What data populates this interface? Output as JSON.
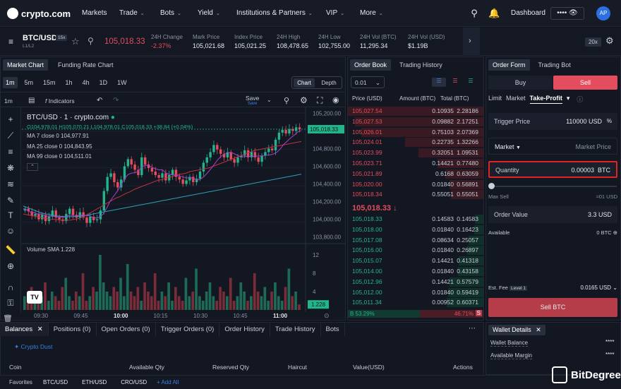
{
  "nav": {
    "logo": "crypto.com",
    "items": [
      {
        "label": "Markets",
        "chev": false
      },
      {
        "label": "Trade",
        "chev": true
      },
      {
        "label": "Bots",
        "chev": true
      },
      {
        "label": "Yield",
        "chev": true
      },
      {
        "label": "Institutions & Partners",
        "chev": true
      },
      {
        "label": "VIP",
        "chev": true
      },
      {
        "label": "More",
        "chev": true
      }
    ],
    "dashboard": "Dashboard",
    "avatar": "AP"
  },
  "ticker": {
    "pair": "BTC/USD",
    "leverage_badge": "15x",
    "sub": "L1/L2",
    "price": "105,018.33",
    "stats": [
      {
        "label": "24H Change",
        "value": "-2.37%"
      },
      {
        "label": "Mark Price",
        "value": "105,021.68"
      },
      {
        "label": "Index Price",
        "value": "105,021.25"
      },
      {
        "label": "24H High",
        "value": "108,478.65"
      },
      {
        "label": "24H Low",
        "value": "102,755.00"
      },
      {
        "label": "24H Vol (BTC)",
        "value": "11,295.34"
      },
      {
        "label": "24H Vol (USD)",
        "value": "$1.19B"
      }
    ],
    "leverage": "20x"
  },
  "chart_panel": {
    "tabs": [
      "Market Chart",
      "Funding Rate Chart"
    ],
    "intervals": [
      "1m",
      "5m",
      "15m",
      "1h",
      "4h",
      "1D",
      "1W"
    ],
    "view_tabs": [
      "Chart",
      "Depth"
    ],
    "toolbar_interval": "1m",
    "indicators": "Indicators",
    "save": "Save",
    "save_sub": "Save",
    "legend": {
      "symbol": "BTC/USD · 1 · crypto.com",
      "ohlc": "O104,978.01  H105,070.21  L104,978.01  C105,018.33  +38.84 (+0.04%)",
      "ma7": "MA 7 close 0  104,977.91",
      "ma25": "MA 25 close 0  104,843.95",
      "ma99": "MA 99 close 0  104,511.01",
      "volume": "Volume SMA  1.228"
    },
    "price_ticks": [
      "105,200.00",
      "104,800.00",
      "104,600.00",
      "104,400.00",
      "104,200.00",
      "104,000.00",
      "103,800.00"
    ],
    "last_price_tag": "105,018.33",
    "volume_ticks": [
      "12",
      "8",
      "4"
    ],
    "volume_tag": "1.228",
    "time_ticks": [
      "09:30",
      "09:45",
      "10:00",
      "10:15",
      "10:30",
      "10:45",
      "11:00"
    ]
  },
  "chart_data": {
    "type": "candlestick",
    "title": "BTC/USD · 1 · crypto.com",
    "ylim": [
      103750,
      105250
    ],
    "last": 105018.33,
    "close_series": [
      104120,
      104090,
      104040,
      104060,
      104000,
      104050,
      103980,
      104030,
      104100,
      104020,
      104000,
      103980,
      104060,
      104120,
      104050,
      104020,
      104080,
      104020,
      103960,
      104030,
      103990,
      104000,
      104100,
      104320,
      104480,
      104520,
      104420,
      104360,
      104450,
      104600,
      104680,
      104620,
      104560,
      104500,
      104700,
      104620,
      104580,
      104540,
      104500,
      104470,
      104520,
      104440,
      104500,
      104560,
      104480,
      104450,
      104400,
      104440,
      104480,
      104420,
      104460,
      104540,
      104640,
      104700,
      104760,
      104840,
      104790,
      104740,
      104700,
      104760,
      104680,
      104640,
      104700,
      104720,
      104780,
      104700,
      104760,
      104700,
      104650,
      104720,
      104760,
      104800,
      104780,
      104900,
      104980,
      105010,
      104970,
      105020,
      105000,
      105040,
      105018
    ],
    "ma25": [
      104060,
      104050,
      104040,
      104030,
      104020,
      104010,
      104000,
      104000,
      103990,
      103990,
      103990,
      104000,
      104010,
      104030,
      104060,
      104090,
      104120,
      104150,
      104180,
      104210,
      104240,
      104260,
      104290,
      104310,
      104340,
      104360,
      104380,
      104400,
      104420,
      104440,
      104450,
      104470,
      104480,
      104500,
      104510,
      104520,
      104540,
      104550,
      104560,
      104570,
      104580,
      104600,
      104620,
      104640,
      104660,
      104680,
      104700,
      104720,
      104740,
      104760,
      104780,
      104790,
      104800,
      104810,
      104820,
      104830,
      104840,
      104850,
      104860,
      104870,
      104880
    ],
    "ma99": [
      104150,
      104130,
      104110,
      104090,
      104070,
      104060,
      104050,
      104040,
      104035,
      104030,
      104030,
      104030,
      104035,
      104040,
      104050,
      104060,
      104070,
      104080,
      104090,
      104100,
      104110,
      104120,
      104130,
      104140,
      104150,
      104160,
      104170,
      104180,
      104190,
      104200,
      104210,
      104220,
      104230,
      104240,
      104250,
      104260,
      104270,
      104280,
      104290,
      104300,
      104310,
      104320,
      104330,
      104340,
      104350,
      104360,
      104370,
      104380,
      104390,
      104400,
      104410,
      104420,
      104430,
      104440,
      104450,
      104460,
      104470,
      104480,
      104490,
      104500,
      104511
    ],
    "volume": [
      3,
      2,
      5,
      4,
      2,
      3,
      6,
      2,
      4,
      3,
      2,
      5,
      7,
      3,
      2,
      4,
      3,
      8,
      2,
      3,
      5,
      4,
      12,
      6,
      4,
      3,
      5,
      4,
      7,
      3,
      10,
      4,
      3,
      5,
      2,
      6,
      4,
      3,
      8,
      2,
      4,
      3,
      6,
      2,
      5,
      3,
      2,
      7,
      3,
      4,
      9,
      3,
      2,
      4,
      6,
      3,
      2,
      5,
      4,
      3,
      7,
      2,
      3,
      6,
      4,
      2,
      3,
      8,
      4,
      3,
      5,
      2,
      4,
      6,
      3,
      2,
      5,
      9,
      3,
      4,
      1.2
    ],
    "volume_ylim": [
      0,
      14
    ]
  },
  "orderbook": {
    "tabs": [
      "Order Book",
      "Trading History"
    ],
    "precision": "0.01",
    "headers": [
      "Price (USD)",
      "Amount (BTC)",
      "Total (BTC)"
    ],
    "asks": [
      {
        "price": "105,027.54",
        "amount": "0.10935",
        "total": "2.28186",
        "depth": 1.0
      },
      {
        "price": "105,027.53",
        "amount": "0.09882",
        "total": "2.17251",
        "depth": 0.95
      },
      {
        "price": "105,026.01",
        "amount": "0.75103",
        "total": "2.07369",
        "depth": 0.9
      },
      {
        "price": "105,024.01",
        "amount": "0.22735",
        "total": "1.32266",
        "depth": 0.58
      },
      {
        "price": "105,023.99",
        "amount": "0.32051",
        "total": "1.09531",
        "depth": 0.48
      },
      {
        "price": "105,023.71",
        "amount": "0.14421",
        "total": "0.77480",
        "depth": 0.34
      },
      {
        "price": "105,021.89",
        "amount": "0.6168",
        "total": "0.63059",
        "depth": 0.28
      },
      {
        "price": "105,020.00",
        "amount": "0.01840",
        "total": "0.56891",
        "depth": 0.25
      },
      {
        "price": "105,018.34",
        "amount": "0.55051",
        "total": "0.55051",
        "depth": 0.24
      }
    ],
    "mid_price": "105,018.33",
    "bids": [
      {
        "price": "105,018.33",
        "amount": "0.14583",
        "total": "0.14583",
        "depth": 0.06
      },
      {
        "price": "105,018.00",
        "amount": "0.01840",
        "total": "0.16423",
        "depth": 0.07
      },
      {
        "price": "105,017.08",
        "amount": "0.08634",
        "total": "0.25057",
        "depth": 0.11
      },
      {
        "price": "105,016.00",
        "amount": "0.01840",
        "total": "0.26897",
        "depth": 0.12
      },
      {
        "price": "105,015.07",
        "amount": "0.14421",
        "total": "0.41318",
        "depth": 0.18
      },
      {
        "price": "105,014.00",
        "amount": "0.01840",
        "total": "0.43158",
        "depth": 0.19
      },
      {
        "price": "105,012.96",
        "amount": "0.14421",
        "total": "0.57579",
        "depth": 0.25
      },
      {
        "price": "105,012.00",
        "amount": "0.01840",
        "total": "0.59419",
        "depth": 0.26
      },
      {
        "price": "105,011.34",
        "amount": "0.00952",
        "total": "0.60371",
        "depth": 0.27
      }
    ],
    "buy_ratio": "B 53.29%",
    "sell_ratio": "46.71%",
    "sell_badge": "S",
    "buy_fraction": 0.5329
  },
  "order_form": {
    "tabs": [
      "Order Form",
      "Trading Bot"
    ],
    "buy": "Buy",
    "sell": "Sell",
    "types": [
      "Limit",
      "Market",
      "Take-Profit"
    ],
    "trigger_label": "Trigger Price",
    "trigger_value": "110000",
    "trigger_unit": "USD",
    "market_label": "Market",
    "market_placeholder": "Market Price",
    "quantity_label": "Quantity",
    "quantity_value": "0.00003",
    "quantity_unit": "BTC",
    "slider_fraction": 0,
    "max_sell_label": "Max Sell",
    "max_sell_value": "≈01 USD",
    "order_value_label": "Order Value",
    "order_value": "3.3 USD",
    "available_label": "Available",
    "available_value": "0 BTC",
    "est_fee_label": "Est. Fee",
    "fee_level": "Level 1",
    "est_fee_value": "0.0165 USD",
    "submit": "Sell BTC",
    "colors": {
      "sell": "#e34d5d",
      "submit": "#b53d4a",
      "highlight": "#e02424"
    }
  },
  "bottom": {
    "tabs": [
      "Balances",
      "Positions (0)",
      "Open Orders (0)",
      "Trigger Orders (0)",
      "Order History",
      "Trade History",
      "Bots"
    ],
    "crypto_dust": "Crypto Dust",
    "columns": [
      "Coin",
      "Available Qty",
      "Reserved Qty",
      "Haircut",
      "Value(USD)",
      "Actions"
    ],
    "favorites_label": "Favorites",
    "favorites": [
      "BTC/USD",
      "ETH/USD",
      "CRO/USD"
    ],
    "add_all": "+ Add All"
  },
  "wallet": {
    "title": "Wallet Details",
    "balance": "Wallet Balance",
    "margin": "Available Margin",
    "balance_value": "****",
    "margin_value": "****"
  },
  "watermark": "BitDegree"
}
